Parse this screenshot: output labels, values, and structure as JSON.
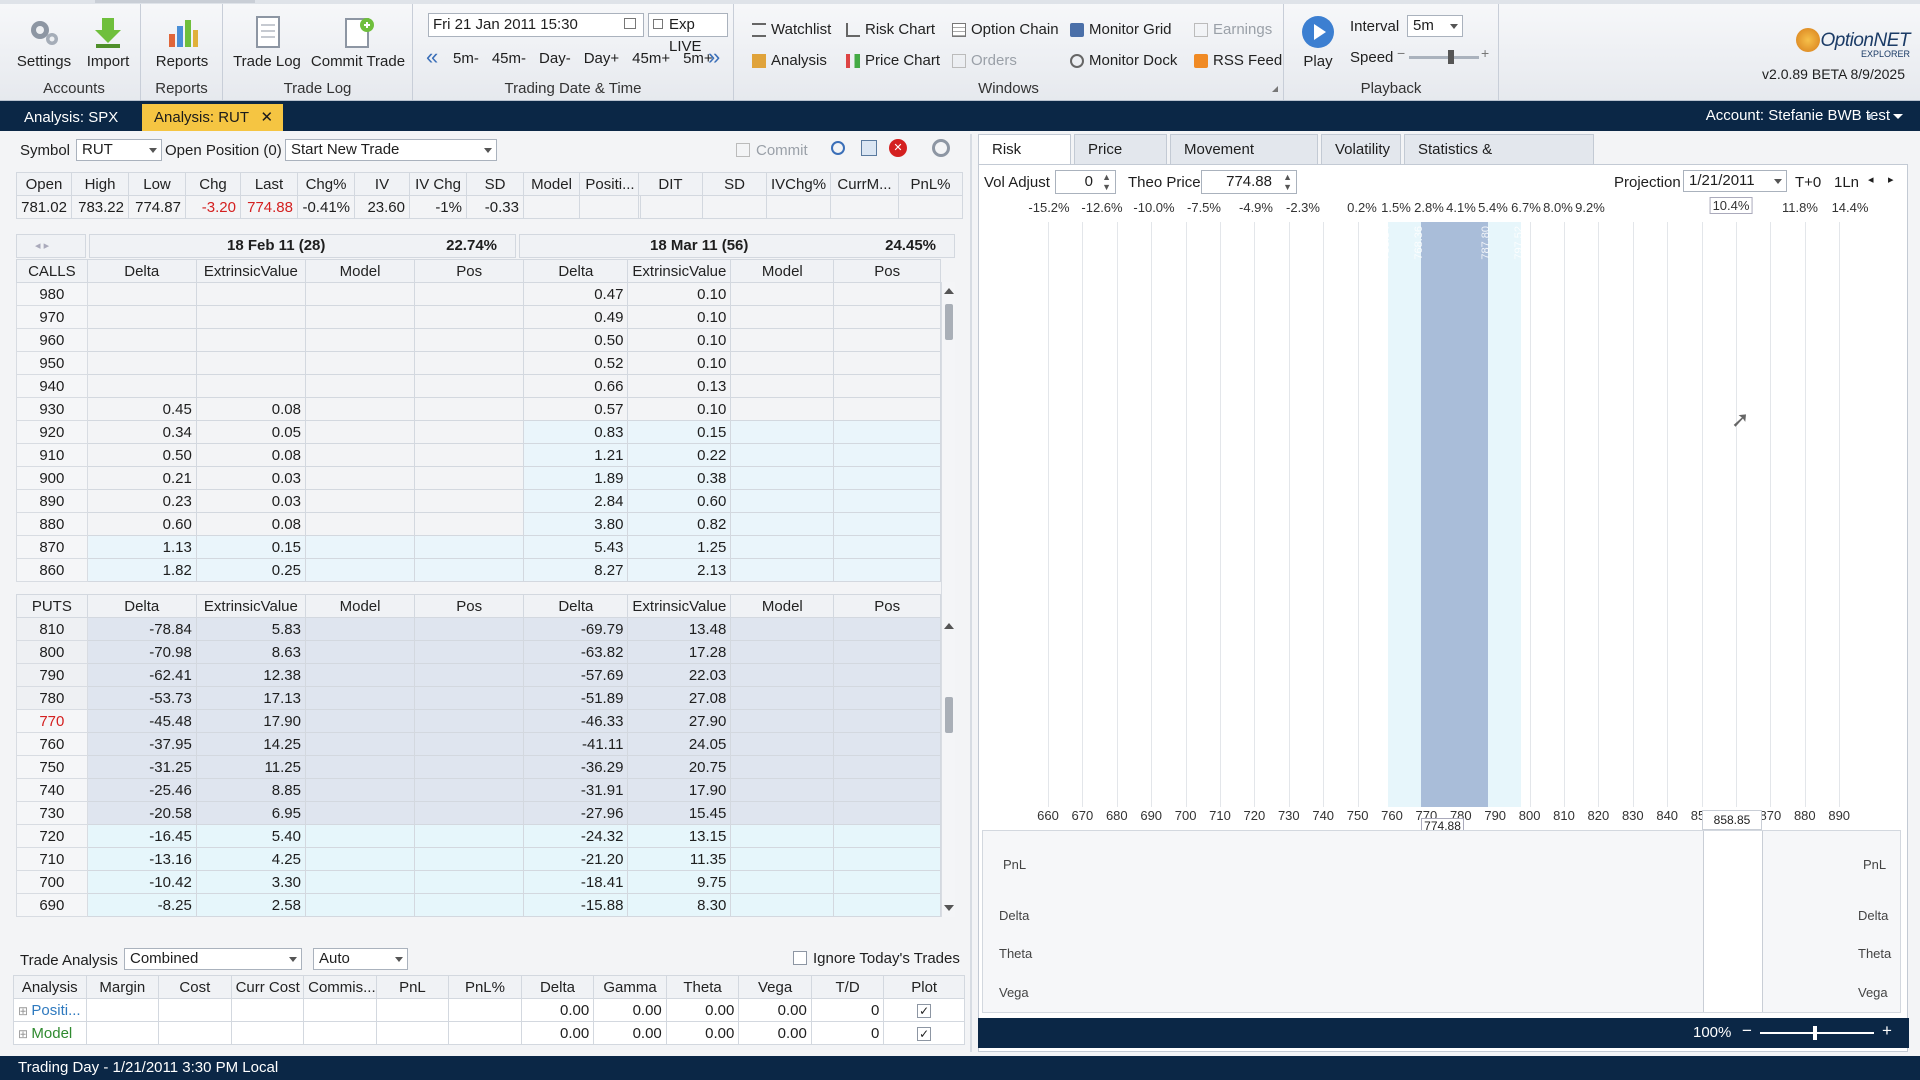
{
  "ribbon": {
    "accounts": {
      "group": "Accounts",
      "settings": "Settings",
      "import": "Import"
    },
    "reports": {
      "group": "Reports",
      "reports": "Reports"
    },
    "tradelog": {
      "group": "Trade Log",
      "tradelog": "Trade Log",
      "commit": "Commit Trade"
    },
    "date": {
      "group": "Trading Date & Time",
      "value": "Fri 21 Jan 2011 15:30",
      "exp": "Exp LIVE",
      "steps": [
        "5m-",
        "45m-",
        "Day-",
        "Day+",
        "45m+",
        "5m+"
      ]
    },
    "windows": {
      "group": "Windows",
      "col1": [
        "Watchlist",
        "Analysis"
      ],
      "col2": [
        "Risk Chart",
        "Price Chart"
      ],
      "col3": [
        "Option Chain",
        "Orders"
      ],
      "col4": [
        "Monitor Grid",
        "Monitor Dock"
      ],
      "col5": [
        "Earnings",
        "RSS Feed"
      ]
    },
    "playback": {
      "group": "Playback",
      "play": "Play",
      "interval_label": "Interval",
      "interval": "5m",
      "speed_label": "Speed",
      "speed": 0.6
    },
    "brand": {
      "name": "OptionNET",
      "sub": "EXPLORER",
      "version": "v2.0.89 BETA 8/9/2025"
    }
  },
  "tabs": {
    "items": [
      "Analysis: SPX",
      "Analysis: RUT"
    ],
    "account": "Account: Stefanie BWB test"
  },
  "left": {
    "symbol_label": "Symbol",
    "symbol": "RUT",
    "open_position": "Open Position (0)",
    "trade": "Start New Trade",
    "commit": "Commit",
    "quote_headers": [
      "Open",
      "High",
      "Low",
      "Chg",
      "Last",
      "Chg%",
      "IV",
      "IV Chg",
      "SD",
      "Model",
      "Positi..."
    ],
    "quote_values": [
      "781.02",
      "783.22",
      "774.87",
      "-3.20",
      "774.88",
      "-0.41%",
      "23.60",
      "-1%",
      "-0.33",
      "",
      ""
    ],
    "pnl_headers": [
      "DIT",
      "SD",
      "IVChg%",
      "CurrM...",
      "PnL%"
    ],
    "exp1": {
      "label": "18 Feb 11 (28)",
      "iv": "22.74%"
    },
    "exp2": {
      "label": "18 Mar 11 (56)",
      "iv": "24.45%"
    },
    "col_headers": [
      "Delta",
      "ExtrinsicValue",
      "Model",
      "Pos"
    ],
    "calls_label": "CALLS",
    "puts_label": "PUTS",
    "calls": [
      {
        "k": "980",
        "d1": "",
        "e1": "",
        "d2": "0.47",
        "e2": "0.10"
      },
      {
        "k": "970",
        "d1": "",
        "e1": "",
        "d2": "0.49",
        "e2": "0.10"
      },
      {
        "k": "960",
        "d1": "",
        "e1": "",
        "d2": "0.50",
        "e2": "0.10"
      },
      {
        "k": "950",
        "d1": "",
        "e1": "",
        "d2": "0.52",
        "e2": "0.10"
      },
      {
        "k": "940",
        "d1": "",
        "e1": "",
        "d2": "0.66",
        "e2": "0.13"
      },
      {
        "k": "930",
        "d1": "0.45",
        "e1": "0.08",
        "d2": "0.57",
        "e2": "0.10"
      },
      {
        "k": "920",
        "d1": "0.34",
        "e1": "0.05",
        "d2": "0.83",
        "e2": "0.15"
      },
      {
        "k": "910",
        "d1": "0.50",
        "e1": "0.08",
        "d2": "1.21",
        "e2": "0.22"
      },
      {
        "k": "900",
        "d1": "0.21",
        "e1": "0.03",
        "d2": "1.89",
        "e2": "0.38"
      },
      {
        "k": "890",
        "d1": "0.23",
        "e1": "0.03",
        "d2": "2.84",
        "e2": "0.60"
      },
      {
        "k": "880",
        "d1": "0.60",
        "e1": "0.08",
        "d2": "3.80",
        "e2": "0.82"
      },
      {
        "k": "870",
        "d1": "1.13",
        "e1": "0.15",
        "d2": "5.43",
        "e2": "1.25"
      },
      {
        "k": "860",
        "d1": "1.82",
        "e1": "0.25",
        "d2": "8.27",
        "e2": "2.13"
      }
    ],
    "puts": [
      {
        "k": "810",
        "d1": "-78.84",
        "e1": "5.83",
        "d2": "-69.79",
        "e2": "13.48"
      },
      {
        "k": "800",
        "d1": "-70.98",
        "e1": "8.63",
        "d2": "-63.82",
        "e2": "17.28"
      },
      {
        "k": "790",
        "d1": "-62.41",
        "e1": "12.38",
        "d2": "-57.69",
        "e2": "22.03"
      },
      {
        "k": "780",
        "d1": "-53.73",
        "e1": "17.13",
        "d2": "-51.89",
        "e2": "27.08"
      },
      {
        "k": "770",
        "d1": "-45.48",
        "e1": "17.90",
        "d2": "-46.33",
        "e2": "27.90"
      },
      {
        "k": "760",
        "d1": "-37.95",
        "e1": "14.25",
        "d2": "-41.11",
        "e2": "24.05"
      },
      {
        "k": "750",
        "d1": "-31.25",
        "e1": "11.25",
        "d2": "-36.29",
        "e2": "20.75"
      },
      {
        "k": "740",
        "d1": "-25.46",
        "e1": "8.85",
        "d2": "-31.91",
        "e2": "17.90"
      },
      {
        "k": "730",
        "d1": "-20.58",
        "e1": "6.95",
        "d2": "-27.96",
        "e2": "15.45"
      },
      {
        "k": "720",
        "d1": "-16.45",
        "e1": "5.40",
        "d2": "-24.32",
        "e2": "13.15"
      },
      {
        "k": "710",
        "d1": "-13.16",
        "e1": "4.25",
        "d2": "-21.20",
        "e2": "11.35"
      },
      {
        "k": "700",
        "d1": "-10.42",
        "e1": "3.30",
        "d2": "-18.41",
        "e2": "9.75"
      },
      {
        "k": "690",
        "d1": "-8.25",
        "e1": "2.58",
        "d2": "-15.88",
        "e2": "8.30"
      }
    ],
    "trade_analysis_label": "Trade Analysis",
    "ta_mode": "Combined",
    "ta_auto": "Auto",
    "ignore_today": "Ignore Today's Trades",
    "analysis_headers": [
      "Analysis",
      "Margin",
      "Cost",
      "Curr Cost",
      "Commis...",
      "PnL",
      "PnL%",
      "Delta",
      "Gamma",
      "Theta",
      "Vega",
      "T/D",
      "Plot"
    ],
    "analysis_rows": [
      {
        "name": "Positi...",
        "delta": "0.00",
        "gamma": "0.00",
        "theta": "0.00",
        "vega": "0.00",
        "td": "0"
      },
      {
        "name": "Model",
        "delta": "0.00",
        "gamma": "0.00",
        "theta": "0.00",
        "vega": "0.00",
        "td": "0"
      }
    ]
  },
  "right": {
    "tabs": [
      "Risk Chart",
      "Price Chart",
      "Movement Analysis",
      "Volatility",
      "Statistics & Fundamentals"
    ],
    "vol_label": "Vol Adjust",
    "vol": "0",
    "theo_label": "Theo Price",
    "theo": "774.88",
    "proj_label": "Projection",
    "proj": "1/21/2011",
    "t0": "T+0",
    "ln": "1Ln",
    "pct_labels": [
      "-15.2%",
      "-12.6%",
      "-10.0%",
      "-7.5%",
      "-4.9%",
      "-2.3%",
      "0.2%",
      "1.5%",
      "2.8%",
      "4.1%",
      "5.4%",
      "6.7%",
      "8.0%",
      "9.2%",
      "10.4%",
      "11.8%",
      "14.4%"
    ],
    "x_labels": [
      "660",
      "670",
      "680",
      "690",
      "700",
      "710",
      "720",
      "730",
      "740",
      "750",
      "760",
      "770",
      "780",
      "790",
      "800",
      "810",
      "820",
      "830",
      "840",
      "850",
      "860",
      "870",
      "880",
      "890"
    ],
    "band_labels": [
      "758.84",
      "768.36",
      "787.80",
      "797.52"
    ],
    "current_price": "774.88",
    "cursor_price": "858.85",
    "greek_labels": [
      "PnL",
      "Delta",
      "Theta",
      "Vega"
    ],
    "zoom": "100%"
  },
  "status": "Trading Day - 1/21/2011 3:30 PM Local",
  "colors": {
    "accent": "#f5c542",
    "navy": "#0b2746",
    "negative": "#d42020",
    "band": "#a9bdd9"
  }
}
